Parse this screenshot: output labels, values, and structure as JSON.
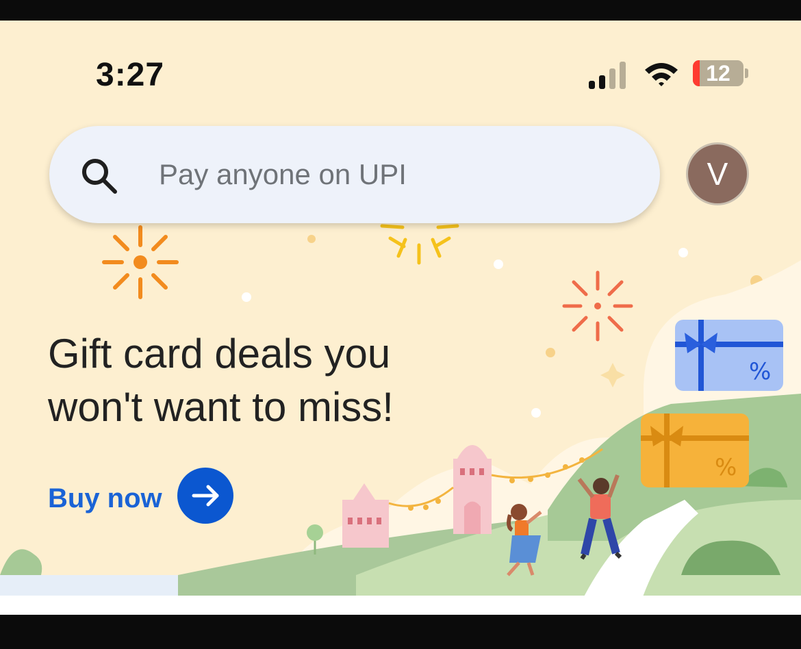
{
  "status_bar": {
    "time": "3:27",
    "battery_level": "12",
    "icons": [
      "cellular-signal-icon",
      "wifi-icon",
      "battery-icon"
    ]
  },
  "search": {
    "placeholder": "Pay anyone on UPI",
    "icon": "search-icon"
  },
  "profile": {
    "avatar_letter": "V",
    "avatar_color": "#8a6a5e"
  },
  "promo": {
    "headline": "Gift card deals you won't want to miss!",
    "cta_label": "Buy now",
    "cta_icon": "arrow-right-icon"
  },
  "colors": {
    "background": "#fdefd0",
    "accent": "#0b57d0",
    "link": "#1a63d6"
  }
}
